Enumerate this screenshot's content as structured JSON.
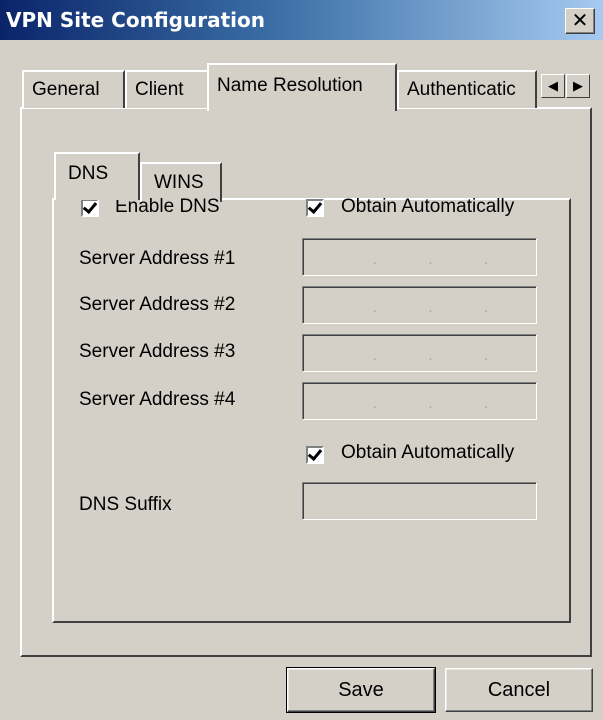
{
  "window": {
    "title": "VPN Site Configuration",
    "close_glyph": "✕"
  },
  "tabs": [
    {
      "label": "General",
      "active": false
    },
    {
      "label": "Client",
      "active": false
    },
    {
      "label": "Name Resolution",
      "active": true
    },
    {
      "label": "Authenticatic",
      "active": false
    }
  ],
  "tab_scroll": {
    "left_icon": "◀",
    "right_icon": "▶"
  },
  "subtabs": [
    {
      "label": "DNS",
      "active": true
    },
    {
      "label": "WINS",
      "active": false
    }
  ],
  "dns": {
    "enable_dns": {
      "label": "Enable DNS",
      "checked": true
    },
    "obtain_servers_auto": {
      "label": "Obtain Automatically",
      "checked": true
    },
    "servers": [
      {
        "label": "Server Address #1",
        "value": ". . ."
      },
      {
        "label": "Server Address #2",
        "value": ". . ."
      },
      {
        "label": "Server Address #3",
        "value": ". . ."
      },
      {
        "label": "Server Address #4",
        "value": ". . ."
      }
    ],
    "obtain_suffix_auto": {
      "label": "Obtain Automatically",
      "checked": true
    },
    "suffix": {
      "label": "DNS Suffix",
      "value": ""
    }
  },
  "buttons": {
    "save": "Save",
    "cancel": "Cancel"
  },
  "colors": {
    "face": "#d4d0c8",
    "title_start": "#0a246a",
    "title_end": "#a6caf0"
  }
}
